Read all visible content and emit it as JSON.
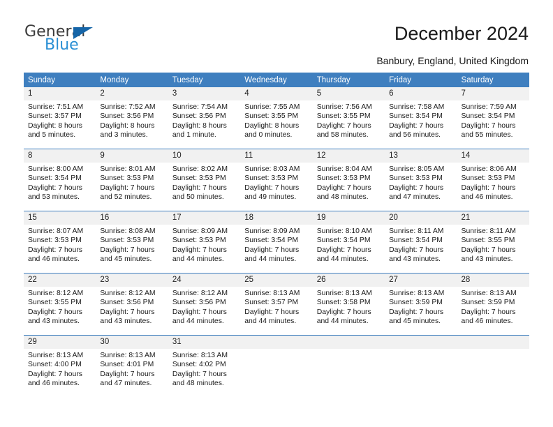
{
  "brand": {
    "name_top": "General",
    "name_bottom": "Blue",
    "triangle_icon": "blue-triangle-icon",
    "color_dark": "#3b3b3b",
    "color_blue": "#2a8fd4",
    "color_triangle": "#1565a8"
  },
  "header": {
    "title": "December 2024",
    "subtitle": "Banbury, England, United Kingdom"
  },
  "colors": {
    "header_row_background": "#3f7fbf",
    "header_row_text": "#ffffff",
    "daynumber_background": "#f1f1f1",
    "cell_background": "#ffffff",
    "grid_line": "#3f7fbf"
  },
  "calendar": {
    "columns": [
      "Sunday",
      "Monday",
      "Tuesday",
      "Wednesday",
      "Thursday",
      "Friday",
      "Saturday"
    ],
    "labels": {
      "sunrise": "Sunrise:",
      "sunset": "Sunset:",
      "daylight": "Daylight:"
    },
    "weeks": [
      [
        {
          "day": "1",
          "sunrise": "Sunrise: 7:51 AM",
          "sunset": "Sunset: 3:57 PM",
          "daylight_line1": "Daylight: 8 hours",
          "daylight_line2": "and 5 minutes."
        },
        {
          "day": "2",
          "sunrise": "Sunrise: 7:52 AM",
          "sunset": "Sunset: 3:56 PM",
          "daylight_line1": "Daylight: 8 hours",
          "daylight_line2": "and 3 minutes."
        },
        {
          "day": "3",
          "sunrise": "Sunrise: 7:54 AM",
          "sunset": "Sunset: 3:56 PM",
          "daylight_line1": "Daylight: 8 hours",
          "daylight_line2": "and 1 minute."
        },
        {
          "day": "4",
          "sunrise": "Sunrise: 7:55 AM",
          "sunset": "Sunset: 3:55 PM",
          "daylight_line1": "Daylight: 8 hours",
          "daylight_line2": "and 0 minutes."
        },
        {
          "day": "5",
          "sunrise": "Sunrise: 7:56 AM",
          "sunset": "Sunset: 3:55 PM",
          "daylight_line1": "Daylight: 7 hours",
          "daylight_line2": "and 58 minutes."
        },
        {
          "day": "6",
          "sunrise": "Sunrise: 7:58 AM",
          "sunset": "Sunset: 3:54 PM",
          "daylight_line1": "Daylight: 7 hours",
          "daylight_line2": "and 56 minutes."
        },
        {
          "day": "7",
          "sunrise": "Sunrise: 7:59 AM",
          "sunset": "Sunset: 3:54 PM",
          "daylight_line1": "Daylight: 7 hours",
          "daylight_line2": "and 55 minutes."
        }
      ],
      [
        {
          "day": "8",
          "sunrise": "Sunrise: 8:00 AM",
          "sunset": "Sunset: 3:54 PM",
          "daylight_line1": "Daylight: 7 hours",
          "daylight_line2": "and 53 minutes."
        },
        {
          "day": "9",
          "sunrise": "Sunrise: 8:01 AM",
          "sunset": "Sunset: 3:53 PM",
          "daylight_line1": "Daylight: 7 hours",
          "daylight_line2": "and 52 minutes."
        },
        {
          "day": "10",
          "sunrise": "Sunrise: 8:02 AM",
          "sunset": "Sunset: 3:53 PM",
          "daylight_line1": "Daylight: 7 hours",
          "daylight_line2": "and 50 minutes."
        },
        {
          "day": "11",
          "sunrise": "Sunrise: 8:03 AM",
          "sunset": "Sunset: 3:53 PM",
          "daylight_line1": "Daylight: 7 hours",
          "daylight_line2": "and 49 minutes."
        },
        {
          "day": "12",
          "sunrise": "Sunrise: 8:04 AM",
          "sunset": "Sunset: 3:53 PM",
          "daylight_line1": "Daylight: 7 hours",
          "daylight_line2": "and 48 minutes."
        },
        {
          "day": "13",
          "sunrise": "Sunrise: 8:05 AM",
          "sunset": "Sunset: 3:53 PM",
          "daylight_line1": "Daylight: 7 hours",
          "daylight_line2": "and 47 minutes."
        },
        {
          "day": "14",
          "sunrise": "Sunrise: 8:06 AM",
          "sunset": "Sunset: 3:53 PM",
          "daylight_line1": "Daylight: 7 hours",
          "daylight_line2": "and 46 minutes."
        }
      ],
      [
        {
          "day": "15",
          "sunrise": "Sunrise: 8:07 AM",
          "sunset": "Sunset: 3:53 PM",
          "daylight_line1": "Daylight: 7 hours",
          "daylight_line2": "and 46 minutes."
        },
        {
          "day": "16",
          "sunrise": "Sunrise: 8:08 AM",
          "sunset": "Sunset: 3:53 PM",
          "daylight_line1": "Daylight: 7 hours",
          "daylight_line2": "and 45 minutes."
        },
        {
          "day": "17",
          "sunrise": "Sunrise: 8:09 AM",
          "sunset": "Sunset: 3:53 PM",
          "daylight_line1": "Daylight: 7 hours",
          "daylight_line2": "and 44 minutes."
        },
        {
          "day": "18",
          "sunrise": "Sunrise: 8:09 AM",
          "sunset": "Sunset: 3:54 PM",
          "daylight_line1": "Daylight: 7 hours",
          "daylight_line2": "and 44 minutes."
        },
        {
          "day": "19",
          "sunrise": "Sunrise: 8:10 AM",
          "sunset": "Sunset: 3:54 PM",
          "daylight_line1": "Daylight: 7 hours",
          "daylight_line2": "and 44 minutes."
        },
        {
          "day": "20",
          "sunrise": "Sunrise: 8:11 AM",
          "sunset": "Sunset: 3:54 PM",
          "daylight_line1": "Daylight: 7 hours",
          "daylight_line2": "and 43 minutes."
        },
        {
          "day": "21",
          "sunrise": "Sunrise: 8:11 AM",
          "sunset": "Sunset: 3:55 PM",
          "daylight_line1": "Daylight: 7 hours",
          "daylight_line2": "and 43 minutes."
        }
      ],
      [
        {
          "day": "22",
          "sunrise": "Sunrise: 8:12 AM",
          "sunset": "Sunset: 3:55 PM",
          "daylight_line1": "Daylight: 7 hours",
          "daylight_line2": "and 43 minutes."
        },
        {
          "day": "23",
          "sunrise": "Sunrise: 8:12 AM",
          "sunset": "Sunset: 3:56 PM",
          "daylight_line1": "Daylight: 7 hours",
          "daylight_line2": "and 43 minutes."
        },
        {
          "day": "24",
          "sunrise": "Sunrise: 8:12 AM",
          "sunset": "Sunset: 3:56 PM",
          "daylight_line1": "Daylight: 7 hours",
          "daylight_line2": "and 44 minutes."
        },
        {
          "day": "25",
          "sunrise": "Sunrise: 8:13 AM",
          "sunset": "Sunset: 3:57 PM",
          "daylight_line1": "Daylight: 7 hours",
          "daylight_line2": "and 44 minutes."
        },
        {
          "day": "26",
          "sunrise": "Sunrise: 8:13 AM",
          "sunset": "Sunset: 3:58 PM",
          "daylight_line1": "Daylight: 7 hours",
          "daylight_line2": "and 44 minutes."
        },
        {
          "day": "27",
          "sunrise": "Sunrise: 8:13 AM",
          "sunset": "Sunset: 3:59 PM",
          "daylight_line1": "Daylight: 7 hours",
          "daylight_line2": "and 45 minutes."
        },
        {
          "day": "28",
          "sunrise": "Sunrise: 8:13 AM",
          "sunset": "Sunset: 3:59 PM",
          "daylight_line1": "Daylight: 7 hours",
          "daylight_line2": "and 46 minutes."
        }
      ],
      [
        {
          "day": "29",
          "sunrise": "Sunrise: 8:13 AM",
          "sunset": "Sunset: 4:00 PM",
          "daylight_line1": "Daylight: 7 hours",
          "daylight_line2": "and 46 minutes."
        },
        {
          "day": "30",
          "sunrise": "Sunrise: 8:13 AM",
          "sunset": "Sunset: 4:01 PM",
          "daylight_line1": "Daylight: 7 hours",
          "daylight_line2": "and 47 minutes."
        },
        {
          "day": "31",
          "sunrise": "Sunrise: 8:13 AM",
          "sunset": "Sunset: 4:02 PM",
          "daylight_line1": "Daylight: 7 hours",
          "daylight_line2": "and 48 minutes."
        },
        {
          "day": "",
          "sunrise": "",
          "sunset": "",
          "daylight_line1": "",
          "daylight_line2": ""
        },
        {
          "day": "",
          "sunrise": "",
          "sunset": "",
          "daylight_line1": "",
          "daylight_line2": ""
        },
        {
          "day": "",
          "sunrise": "",
          "sunset": "",
          "daylight_line1": "",
          "daylight_line2": ""
        },
        {
          "day": "",
          "sunrise": "",
          "sunset": "",
          "daylight_line1": "",
          "daylight_line2": ""
        }
      ]
    ]
  }
}
